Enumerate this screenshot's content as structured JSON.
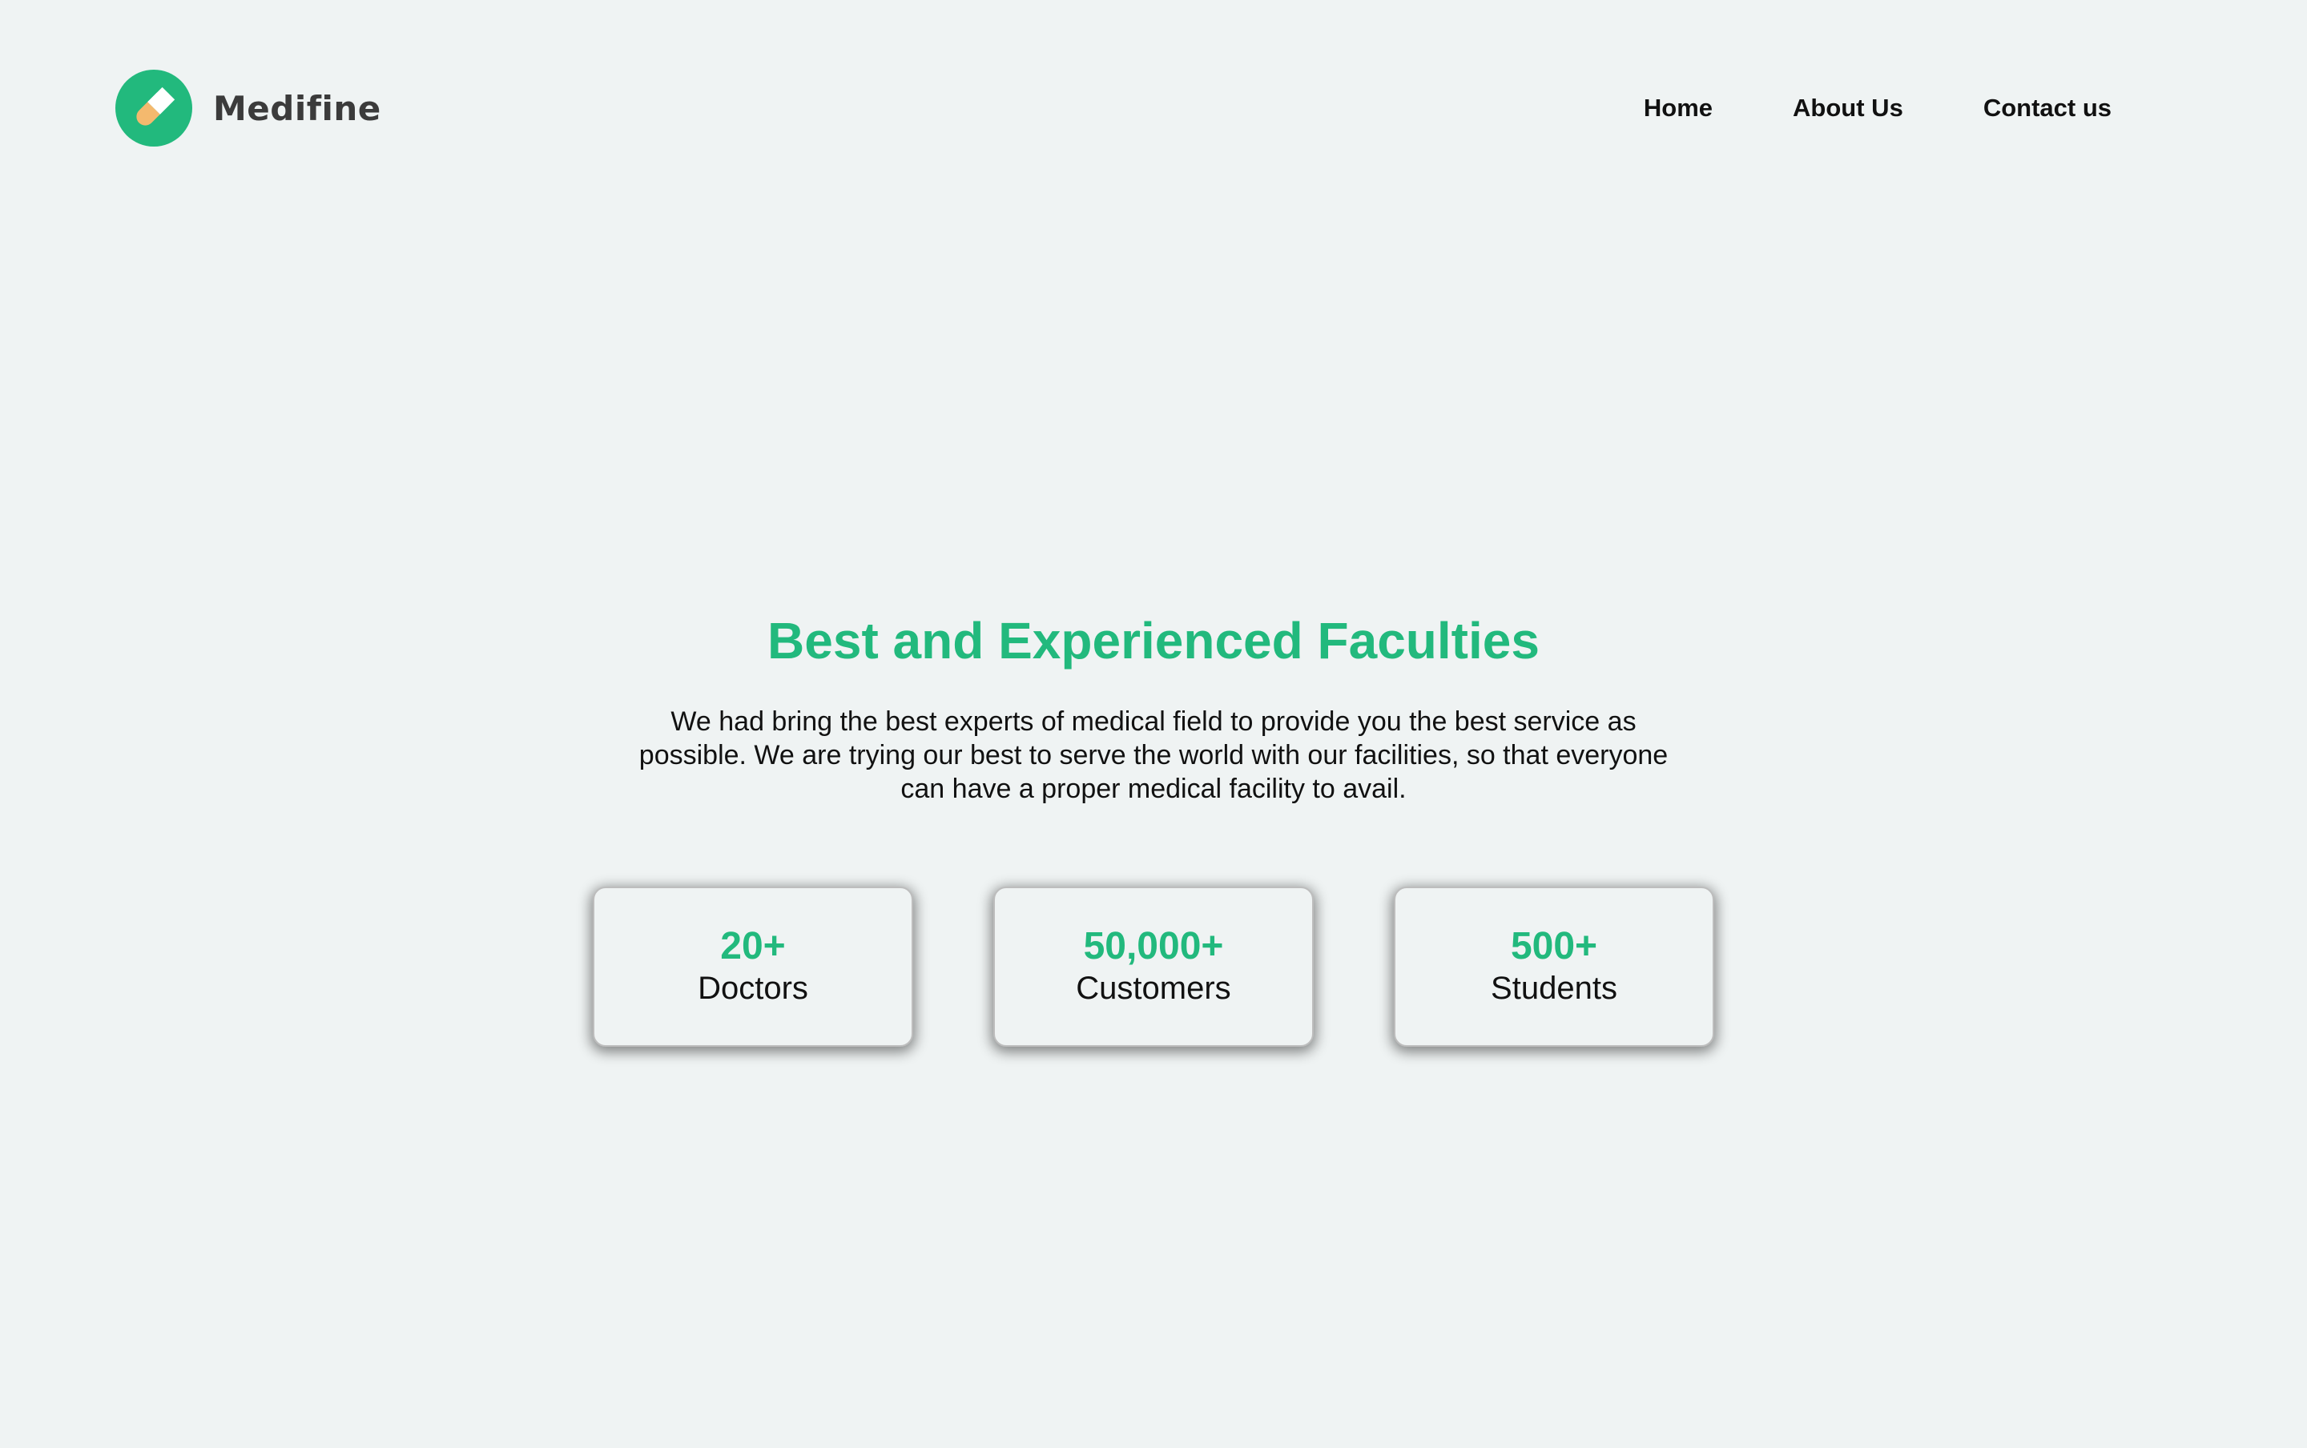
{
  "brand": {
    "name": "Medifine",
    "icon": "pill-icon",
    "accent_color": "#22b97d"
  },
  "nav": {
    "items": [
      {
        "label": "Home"
      },
      {
        "label": "About Us"
      },
      {
        "label": "Contact us"
      }
    ]
  },
  "hero": {
    "title": "Best and Experienced Faculties",
    "description": "We had bring the best experts of medical field to provide you the best service as possible. We are trying our best to serve the world with our facilities, so that everyone can have a proper medical facility to avail."
  },
  "stats": [
    {
      "value": "20+",
      "label": "Doctors"
    },
    {
      "value": "50,000+",
      "label": "Customers"
    },
    {
      "value": "500+",
      "label": "Students"
    }
  ]
}
